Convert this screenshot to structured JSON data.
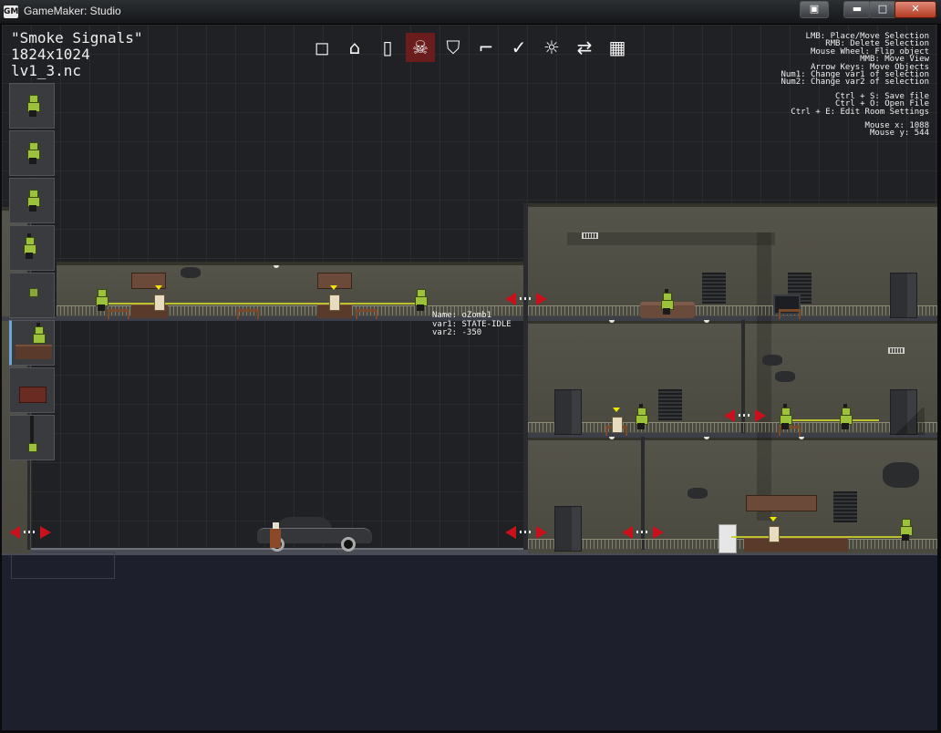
{
  "window": {
    "title": "GameMaker: Studio",
    "buttons": {
      "extra": "▣",
      "minimize": "▬",
      "maximize": "□",
      "close": "✕"
    }
  },
  "level": {
    "title": "\"Smoke Signals\"",
    "size": "1824x1024",
    "file": "lv1_3.nc"
  },
  "toolbar": {
    "tools": [
      {
        "name": "wall-tool",
        "glyph": "◻"
      },
      {
        "name": "home-tool",
        "glyph": "⌂"
      },
      {
        "name": "door-tool",
        "glyph": "▯"
      },
      {
        "name": "enemy-tool",
        "glyph": "☠",
        "active": true
      },
      {
        "name": "shield-tool",
        "glyph": "⛉"
      },
      {
        "name": "gun-tool",
        "glyph": "⌐"
      },
      {
        "name": "check-tool",
        "glyph": "✓"
      },
      {
        "name": "light-tool",
        "glyph": "☼"
      },
      {
        "name": "transition-tool",
        "glyph": "⇄"
      },
      {
        "name": "scenery-tool",
        "glyph": "▦"
      }
    ]
  },
  "help": {
    "lines": [
      "LMB: Place/Move Selection",
      "RMB: Delete Selection",
      "Mouse Wheel: Flip object",
      "MMB: Move View",
      "Arrow Keys: Move Objects",
      "Num1: Change var1 of selection",
      "Num2: Change var2 of selection"
    ],
    "lines2": [
      "Ctrl + S: Save file",
      "Ctrl + O: Open File",
      "Ctrl + E: Edit Room Settings"
    ],
    "mouse_x": "Mouse x: 1088",
    "mouse_y": "Mouse y: 544"
  },
  "palette": {
    "items": [
      "zombie-idle",
      "zombie-standing",
      "zombie-seated",
      "zombie-gunner",
      "zombie-hidden",
      "zombie-desk",
      "guard-dog",
      "zombie-hanging"
    ],
    "selected_index": 5
  },
  "tooltip": {
    "name": "Name: oZomb1",
    "var1": "var1: STATE-IDLE",
    "var2": "var2: -350"
  },
  "colors": {
    "accent_arrow": "#c8111a",
    "zombie": "#9cc13a",
    "sightline": "#c9cf2c",
    "active_tool": "#6b1d1d"
  }
}
